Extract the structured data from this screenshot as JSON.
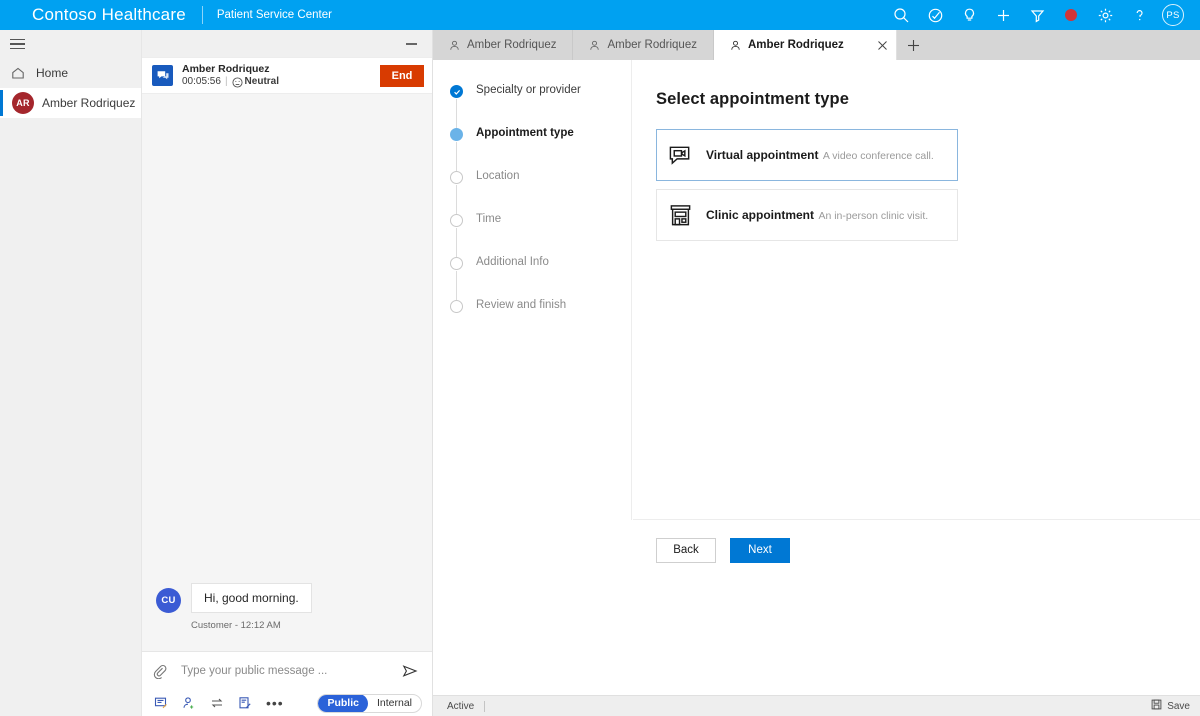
{
  "brand": {
    "title": "Contoso Healthcare",
    "subtitle": "Patient Service Center",
    "actions": [
      {
        "name": "search-icon",
        "label": "Search"
      },
      {
        "name": "assistant-icon",
        "label": "Assistant"
      },
      {
        "name": "lightbulb-icon",
        "label": "Insights"
      },
      {
        "name": "add-icon",
        "label": "Add"
      },
      {
        "name": "filter-icon",
        "label": "Filter"
      },
      {
        "name": "record-icon",
        "label": "Record"
      },
      {
        "name": "gear-icon",
        "label": "Settings"
      },
      {
        "name": "help-icon",
        "label": "Help"
      }
    ],
    "avatar_initials": "PS",
    "accent_color": "#00a1f1"
  },
  "sidebar": {
    "items": [
      {
        "label": "Home",
        "icon": "home-icon",
        "active": false
      },
      {
        "label": "Amber Rodriquez",
        "initials": "AR",
        "active": true
      }
    ],
    "avatar_color": "#a4262c"
  },
  "conversation": {
    "name": "Amber Rodriquez",
    "timer": "00:05:56",
    "divider": "|",
    "sentiment": "Neutral",
    "end_label": "End",
    "end_color": "#d83b01",
    "messages": [
      {
        "initials": "CU",
        "text": "Hi, good morning.",
        "meta": "Customer - 12:12 AM"
      }
    ],
    "composer": {
      "placeholder": "Type your public message ...",
      "value": "",
      "tools": [
        {
          "name": "quick-reply-icon"
        },
        {
          "name": "add-agent-icon"
        },
        {
          "name": "transfer-icon"
        },
        {
          "name": "note-icon"
        },
        {
          "name": "more-options-icon"
        }
      ],
      "toggle": {
        "options": [
          "Public",
          "Internal"
        ],
        "selected": "Public",
        "active_color": "#2b62d9"
      }
    }
  },
  "tabs": [
    {
      "label": "Amber Rodriquez",
      "active": false,
      "closable": false
    },
    {
      "label": "Amber Rodriquez",
      "active": false,
      "closable": false
    },
    {
      "label": "Amber Rodriquez",
      "active": true,
      "closable": true
    }
  ],
  "stepper": {
    "steps": [
      {
        "label": "Specialty or provider",
        "state": "done"
      },
      {
        "label": "Appointment type",
        "state": "current"
      },
      {
        "label": "Location",
        "state": "pending"
      },
      {
        "label": "Time",
        "state": "pending"
      },
      {
        "label": "Additional Info",
        "state": "pending"
      },
      {
        "label": "Review and finish",
        "state": "pending"
      }
    ]
  },
  "content": {
    "title": "Select appointment type",
    "options": [
      {
        "title": "Virtual appointment",
        "desc": "A video conference call.",
        "icon": "video-chat-icon",
        "selected": true
      },
      {
        "title": "Clinic appointment",
        "desc": "An in-person clinic visit.",
        "icon": "clinic-building-icon",
        "selected": false
      }
    ],
    "back_label": "Back",
    "next_label": "Next",
    "next_color": "#0078d4"
  },
  "statusbar": {
    "state": "Active",
    "save_label": "Save"
  }
}
